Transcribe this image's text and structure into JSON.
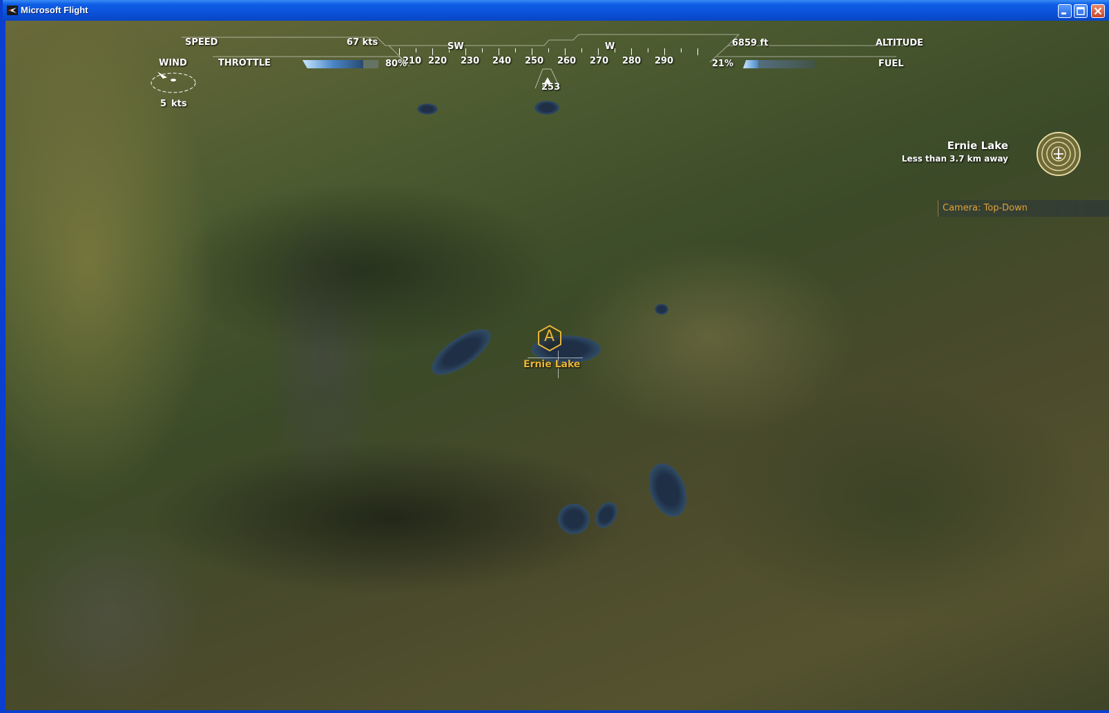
{
  "window": {
    "title": "Microsoft Flight",
    "controls": [
      "minimize",
      "maximize",
      "close"
    ]
  },
  "hud": {
    "speed_label": "SPEED",
    "speed_value": "67 kts",
    "throttle_label": "THROTTLE",
    "throttle_value": "80%",
    "throttle_level": 0.8,
    "altitude_label": "ALTITUDE",
    "altitude_value": "6859 ft",
    "fuel_label": "FUEL",
    "fuel_value": "21%",
    "fuel_level": 0.21,
    "wind_label": "WIND",
    "wind_value": "5",
    "wind_unit": "kts",
    "heading_value": "253",
    "compass_labels": [
      "210",
      "220",
      "230",
      "240",
      "250",
      "260",
      "270",
      "280",
      "290"
    ],
    "compass_cardinals": [
      "SW",
      "W"
    ]
  },
  "destination": {
    "name": "Ernie Lake",
    "distance": "Less than 3.7 km away",
    "marker_letter": "A",
    "marker_label": "Ernie Lake"
  },
  "camera": {
    "status": "Camera: Top-Down"
  },
  "colors": {
    "hud_text": "#ffffff",
    "marker": "#e8b43a",
    "camera_text": "#e0a33a",
    "titlebar": "#0a4fd6"
  }
}
